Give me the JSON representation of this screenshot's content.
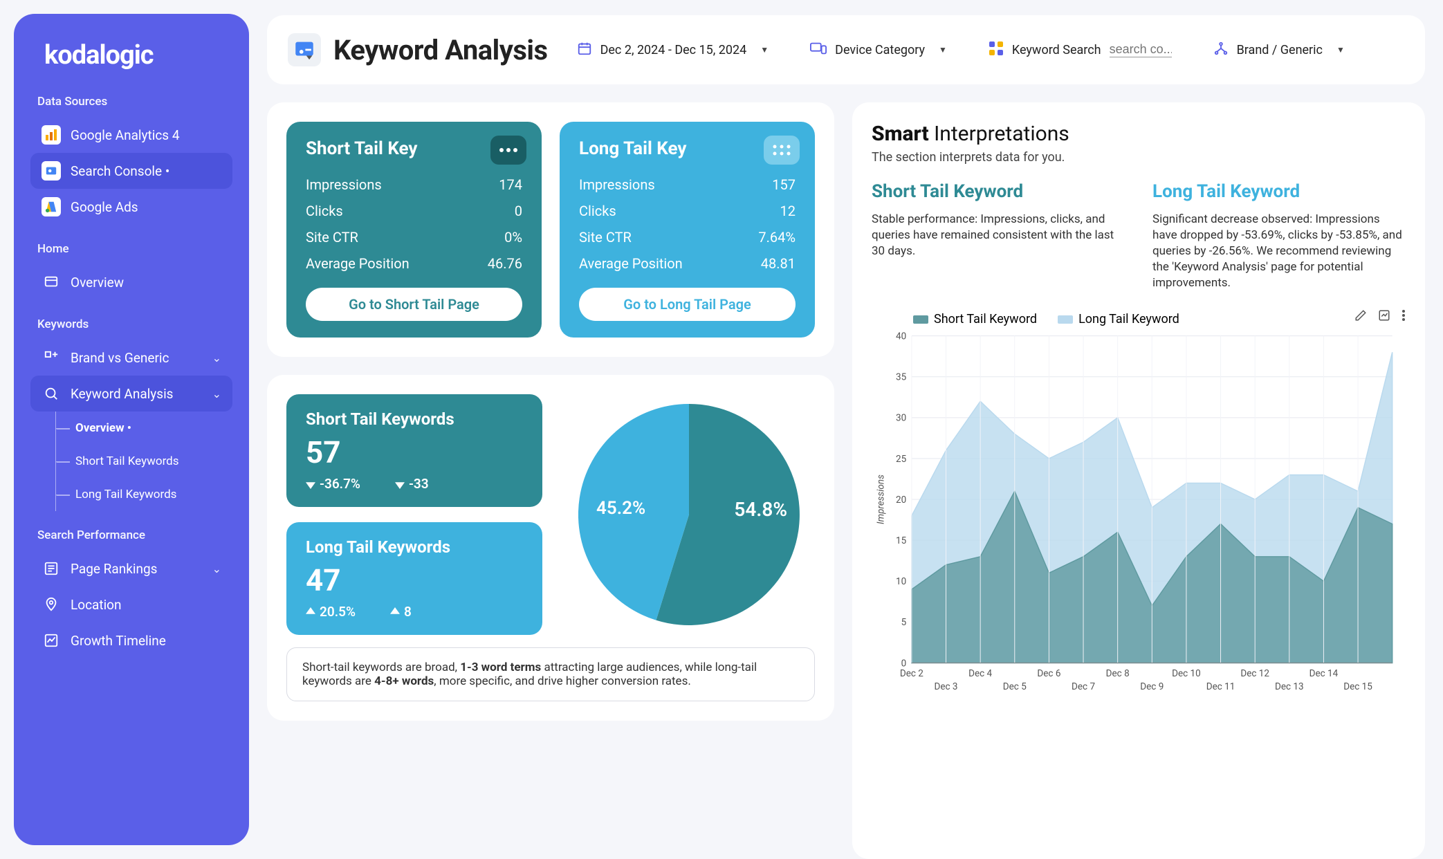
{
  "brand": "kodalogic",
  "sidebar": {
    "sections": {
      "data_sources": {
        "label": "Data Sources",
        "items": [
          {
            "label": "Google Analytics 4"
          },
          {
            "label": "Search Console •"
          },
          {
            "label": "Google Ads"
          }
        ]
      },
      "home": {
        "label": "Home",
        "items": [
          {
            "label": "Overview"
          }
        ]
      },
      "keywords": {
        "label": "Keywords",
        "items": [
          {
            "label": "Brand vs Generic"
          },
          {
            "label": "Keyword Analysis",
            "children": [
              {
                "label": "Overview •"
              },
              {
                "label": "Short Tail Keywords"
              },
              {
                "label": "Long Tail Keywords"
              }
            ]
          }
        ]
      },
      "search_perf": {
        "label": "Search Performance",
        "items": [
          {
            "label": "Page Rankings"
          },
          {
            "label": "Location"
          },
          {
            "label": "Growth Timeline"
          }
        ]
      }
    }
  },
  "header": {
    "title": "Keyword Analysis",
    "date_range": "Dec 2, 2024 - Dec 15, 2024",
    "filters": {
      "device": "Device Category",
      "keyword_label": "Keyword Search",
      "keyword_placeholder": "search co...",
      "brand": "Brand / Generic"
    }
  },
  "short_card": {
    "title": "Short Tail Key",
    "metrics": {
      "impr_label": "Impressions",
      "impr": "174",
      "clicks_label": "Clicks",
      "clicks": "0",
      "ctr_label": "Site CTR",
      "ctr": "0%",
      "pos_label": "Average Position",
      "pos": "46.76"
    },
    "button": "Go to Short Tail Page"
  },
  "long_card": {
    "title": "Long Tail Key",
    "metrics": {
      "impr_label": "Impressions",
      "impr": "157",
      "clicks_label": "Clicks",
      "clicks": "12",
      "ctr_label": "Site CTR",
      "ctr": "7.64%",
      "pos_label": "Average Position",
      "pos": "48.81"
    },
    "button": "Go to Long Tail Page"
  },
  "short_stat": {
    "title": "Short Tail Keywords",
    "value": "57",
    "pct": "-36.7%",
    "abs": "-33"
  },
  "long_stat": {
    "title": "Long Tail Keywords",
    "value": "47",
    "pct": "20.5%",
    "abs": "8"
  },
  "pie": {
    "short_label": "54.8%",
    "long_label": "45.2%"
  },
  "note": {
    "pre": "Short-tail keywords are broad, ",
    "b1": "1-3 word terms",
    "mid": " attracting large audiences, while long-tail keywords are ",
    "b2": "4-8+ words",
    "post": ", more specific, and drive higher conversion rates."
  },
  "smart": {
    "title_bold": "Smart",
    "title_rest": " Interpretations",
    "subtitle": "The section interprets data for you.",
    "short": {
      "heading": "Short Tail Keyword",
      "body": "Stable performance: Impressions, clicks, and queries have remained consistent with the last 30 days."
    },
    "long": {
      "heading": "Long Tail Keyword",
      "body": "Significant decrease observed: Impressions have dropped by -53.69%, clicks by -53.85%, and queries by -26.56%. We recommend reviewing the 'Keyword Analysis' page for potential improvements."
    },
    "legend": {
      "short": "Short Tail Keyword",
      "long": "Long Tail Keyword"
    }
  },
  "chart_data": {
    "type": "area",
    "xlabel": "",
    "ylabel": "Impressions",
    "ylim": [
      0,
      40
    ],
    "y_ticks": [
      0,
      5,
      10,
      15,
      20,
      25,
      30,
      35,
      40
    ],
    "categories": [
      "Dec 2",
      "Dec 3",
      "Dec 4",
      "Dec 5",
      "Dec 6",
      "Dec 7",
      "Dec 8",
      "Dec 9",
      "Dec 10",
      "Dec 11",
      "Dec 12",
      "Dec 13",
      "Dec 14",
      "Dec 15"
    ],
    "series": [
      {
        "name": "Short Tail Keyword",
        "color": "#5f9aa0",
        "values": [
          9,
          12,
          13,
          21,
          11,
          13,
          16,
          7,
          13,
          17,
          13,
          13,
          10,
          19,
          17
        ]
      },
      {
        "name": "Long Tail Keyword",
        "color": "#b9d9ee",
        "values": [
          18,
          26,
          32,
          28,
          25,
          27,
          30,
          19,
          22,
          22,
          20,
          23,
          23,
          21,
          38
        ]
      }
    ]
  }
}
